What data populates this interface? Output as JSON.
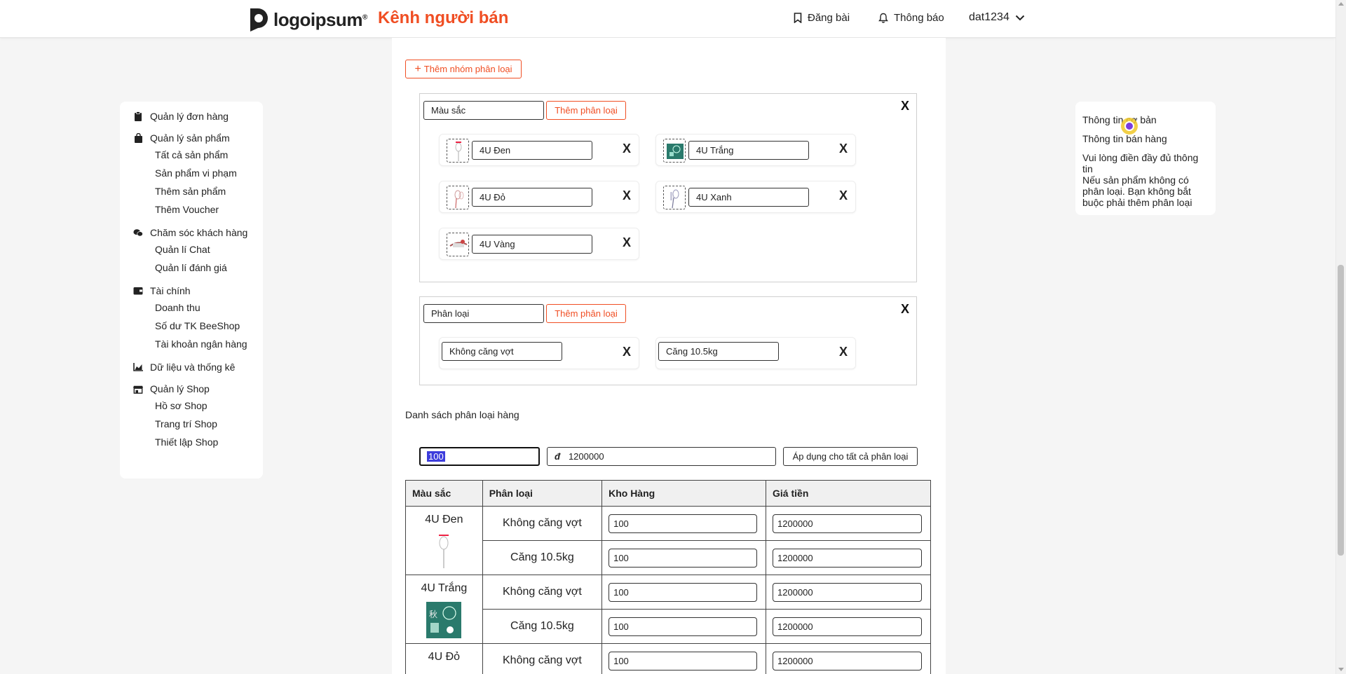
{
  "header": {
    "logo_text": "logoipsum",
    "channel_title": "Kênh người bán",
    "post_label": "Đăng bài",
    "notify_label": "Thông báo",
    "username": "dat1234"
  },
  "sidebar": {
    "groups": [
      {
        "label": "Quản lý đơn hàng",
        "icon": "clipboard-icon",
        "items": []
      },
      {
        "label": "Quản lý sản phẩm",
        "icon": "shopping-bag-icon",
        "items": [
          "Tất cả sản phẩm",
          "Sản phẩm vi phạm",
          "Thêm sản phẩm",
          "Thêm Voucher"
        ]
      },
      {
        "label": "Chăm sóc khách hàng",
        "icon": "chat-bubbles-icon",
        "items": [
          "Quản lí Chat",
          "Quản lí đánh giá"
        ]
      },
      {
        "label": "Tài chính",
        "icon": "wallet-icon",
        "items": [
          "Doanh thu",
          "Số dư TK BeeShop",
          "Tài khoản ngân hàng"
        ]
      },
      {
        "label": "Dữ liệu và thống kê",
        "icon": "area-chart-icon",
        "items": []
      },
      {
        "label": "Quản lý Shop",
        "icon": "store-icon",
        "items": [
          "Hồ sơ Shop",
          "Trang trí Shop",
          "Thiết lập Shop"
        ]
      }
    ]
  },
  "variants": {
    "add_group_label": "Thêm nhóm phân loại",
    "add_option_label": "Thêm phân loại",
    "close_glyph": "X",
    "groups": [
      {
        "name": "Màu sắc",
        "options": [
          "4U Đen",
          "4U Trắng",
          "4U Đỏ",
          "4U Xanh",
          "4U Vàng"
        ]
      },
      {
        "name": "Phân loại",
        "options": [
          "Không căng vợt",
          "Căng 10.5kg"
        ]
      }
    ],
    "list_title": "Danh sách phân loại hàng",
    "bulk": {
      "stock_value": "100",
      "currency_symbol": "đ",
      "price_value": "1200000",
      "apply_label": "Áp dụng cho tất cả phân loại"
    }
  },
  "table": {
    "headers": [
      "Màu sắc",
      "Phân loại",
      "Kho Hàng",
      "Giá tiền"
    ],
    "rows": [
      {
        "color": "4U Đen",
        "kind": "Không căng vợt",
        "stock": "100",
        "price": "1200000"
      },
      {
        "color": "4U Đen",
        "kind": "Căng 10.5kg",
        "stock": "100",
        "price": "1200000"
      },
      {
        "color": "4U Trắng",
        "kind": "Không căng vợt",
        "stock": "100",
        "price": "1200000"
      },
      {
        "color": "4U Trắng",
        "kind": "Căng 10.5kg",
        "stock": "100",
        "price": "1200000"
      },
      {
        "color": "4U Đỏ",
        "kind": "Không căng vợt",
        "stock": "100",
        "price": "1200000"
      }
    ]
  },
  "info_panel": {
    "basic_info": "Thông tin cơ bản",
    "sales_info": "Thông tin bán hàng",
    "note1": "Vui lòng điền đầy đủ thông tin",
    "note2": "Nếu sản phẩm không có phân loại. Bạn không bắt buộc phải thêm phân loại"
  },
  "colors": {
    "accent": "#f04e23",
    "selection": "#3d3ddc"
  }
}
